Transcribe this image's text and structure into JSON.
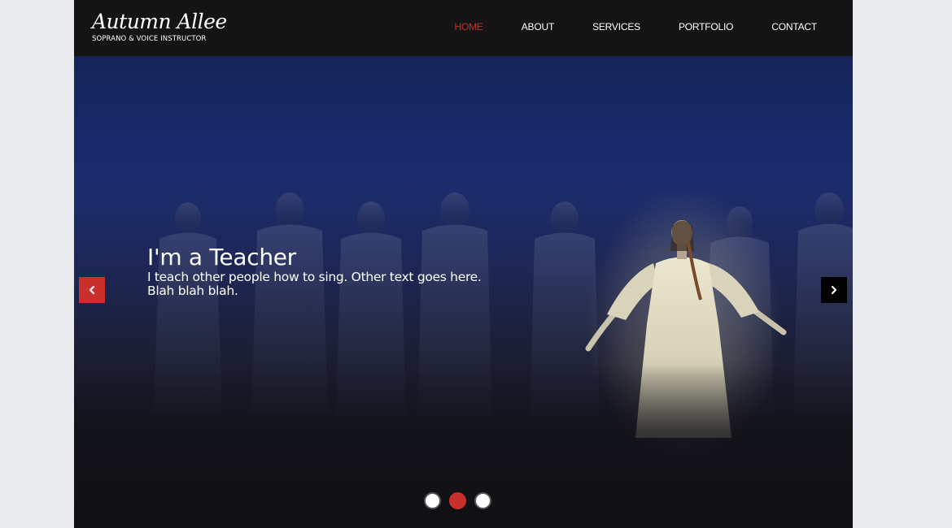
{
  "header": {
    "logo_script": "Autumn Allee",
    "logo_subtitle": "SOPRANO & VOICE INSTRUCTOR",
    "nav": [
      {
        "label": "HOME",
        "active": true
      },
      {
        "label": "ABOUT",
        "active": false
      },
      {
        "label": "SERVICES",
        "active": false
      },
      {
        "label": "PORTFOLIO",
        "active": false
      },
      {
        "label": "CONTACT",
        "active": false
      }
    ]
  },
  "hero": {
    "title": "I'm a Teacher",
    "text": "I teach other people how to sing. Other text goes here. Blah blah blah.",
    "prev_icon": "chevron-left-icon",
    "next_icon": "chevron-right-icon",
    "active_slide": 2,
    "slide_count": 3
  },
  "colors": {
    "accent": "#c9302c",
    "header_bg": "#141414",
    "page_bg": "#e9eaed"
  }
}
